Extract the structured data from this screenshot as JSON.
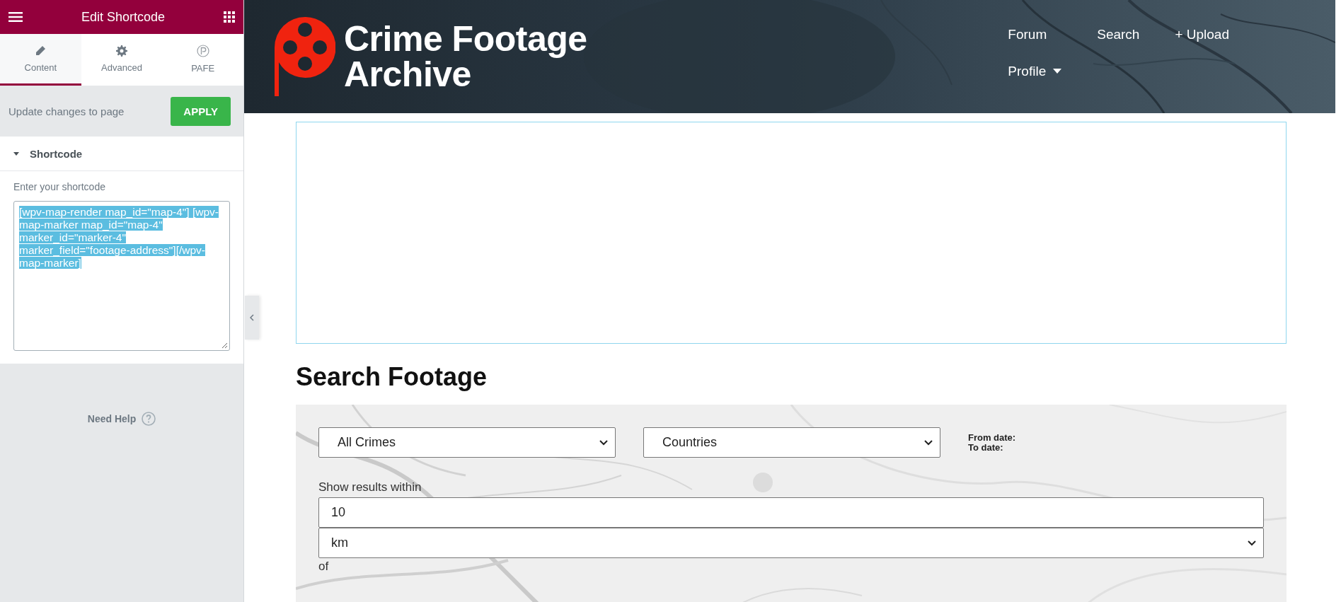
{
  "editor": {
    "title": "Edit Shortcode",
    "tabs": [
      {
        "label": "Content",
        "kind": "pencil",
        "selected": true
      },
      {
        "label": "Advanced",
        "kind": "gear",
        "selected": false
      },
      {
        "label": "PAFE",
        "kind": "badge",
        "selected": false
      }
    ],
    "update_label": "Update changes to page",
    "apply_button": "APPLY",
    "section": {
      "title": "Shortcode",
      "expanded": true
    },
    "field_label": "Enter your shortcode",
    "shortcode": "[wpv-map-render map_id=\"map-4\"] [wpv-map-marker map_id=\"map-4\" marker_id=\"marker-4\" marker_field=\"footage-address\"][/wpv-map-marker]",
    "shortcode_selected": true,
    "help": "Need Help"
  },
  "site": {
    "logo": {
      "line1": "Crime Footage",
      "line2": "Archive"
    },
    "nav": [
      {
        "label": "Forum",
        "kind": "link"
      },
      {
        "label": "Search",
        "kind": "link"
      },
      {
        "label": "+ Upload",
        "kind": "link"
      },
      {
        "label": "Profile",
        "kind": "dropdown"
      }
    ]
  },
  "heading": "Search Footage",
  "form": {
    "crime_select": "All Crimes",
    "country_select": "Countries",
    "from_date_label": "From date:",
    "to_date_label": "To date:",
    "radius_label": "Show results within",
    "radius_value": "10",
    "unit_select": "km",
    "of_label": "of"
  }
}
